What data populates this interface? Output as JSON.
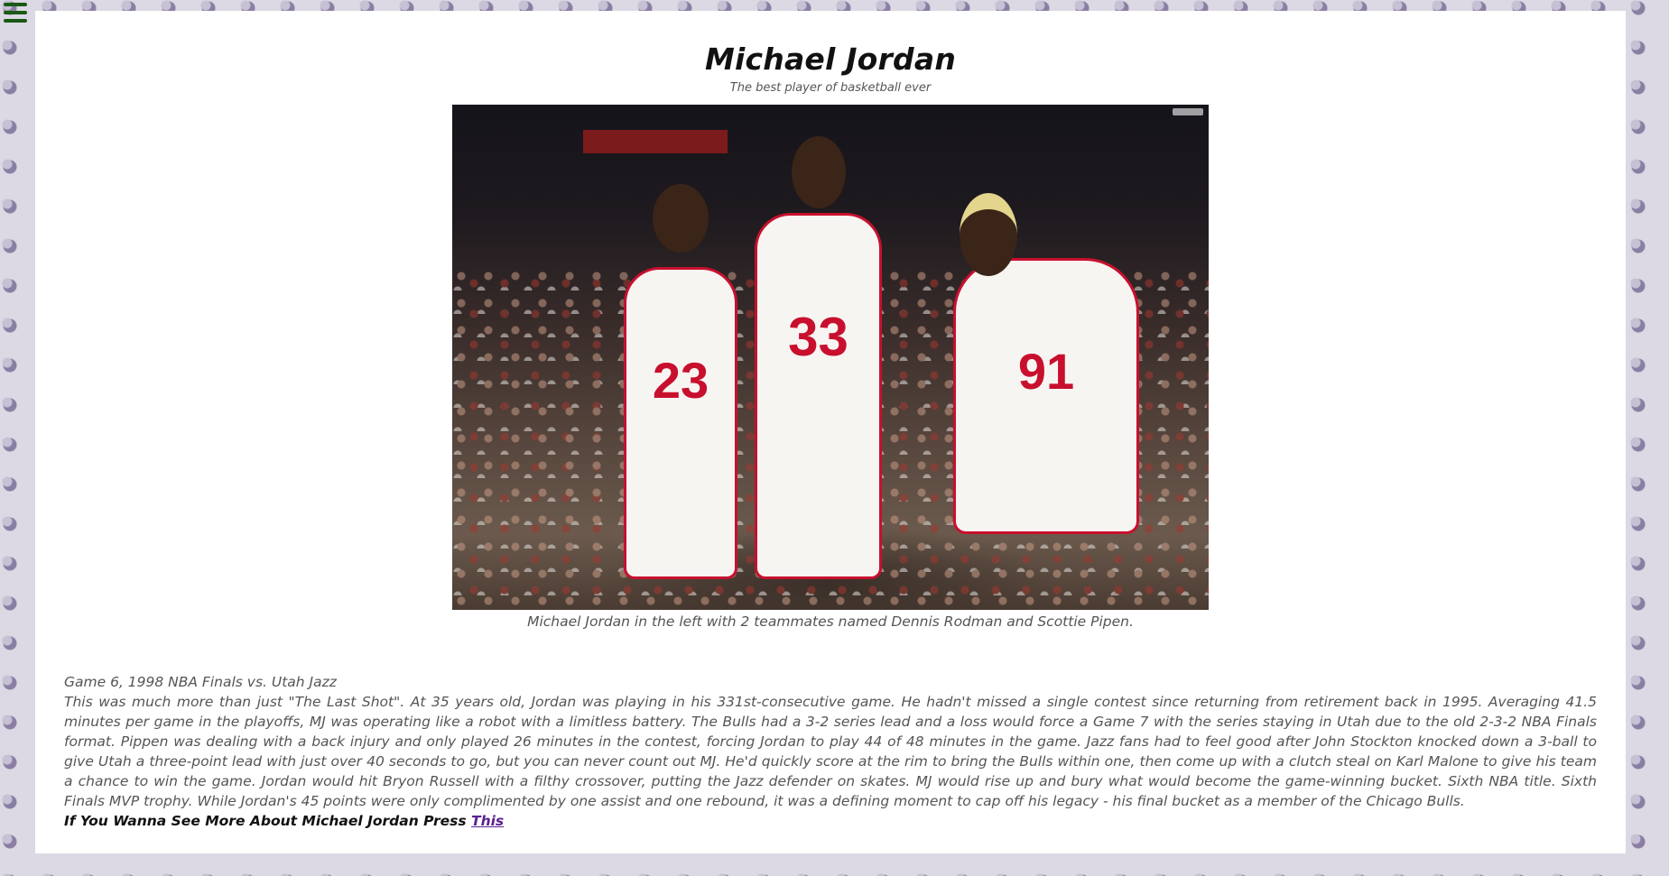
{
  "nav": {
    "menu_icon": "hamburger-menu-icon",
    "menu_color": "#1a5a14"
  },
  "header": {
    "title": "Michael Jordan",
    "subtitle": "The best player of basketball ever"
  },
  "photo": {
    "jersey_numbers": [
      "23",
      "33",
      "91"
    ],
    "caption": "Michael Jordan in the left with 2 teammates named Dennis Rodman and Scottie Pipen."
  },
  "article": {
    "heading": "Game 6, 1998 NBA Finals vs. Utah Jazz",
    "body": "This was much more than just \"The Last Shot\". At 35 years old, Jordan was playing in his 331st-consecutive game. He hadn't missed a single contest since returning from retirement back in 1995. Averaging 41.5 minutes per game in the playoffs, MJ was operating like a robot with a limitless battery. The Bulls had a 3-2 series lead and a loss would force a Game 7 with the series staying in Utah due to the old 2-3-2 NBA Finals format. Pippen was dealing with a back injury and only played 26 minutes in the contest, forcing Jordan to play 44 of 48 minutes in the game. Jazz fans had to feel good after John Stockton knocked down a 3-ball to give Utah a three-point lead with just over 40 seconds to go, but you can never count out MJ. He'd quickly score at the rim to bring the Bulls within one, then come up with a clutch steal on Karl Malone to give his team a chance to win the game. Jordan would hit Bryon Russell with a filthy crossover, putting the Jazz defender on skates. MJ would rise up and bury what would become the game-winning bucket. Sixth NBA title. Sixth Finals MVP trophy. While Jordan's 45 points were only complimented by one assist and one rebound, it was a defining moment to cap off his legacy - his final bucket as a member of the Chicago Bulls."
  },
  "cta": {
    "text": "If You Wanna See More About Michael Jordan Press ",
    "link_label": "This"
  },
  "colors": {
    "background": "#dcd9e4",
    "pattern": "#8a7fa3",
    "link": "#5a2190",
    "jersey_red": "#c8102e"
  }
}
